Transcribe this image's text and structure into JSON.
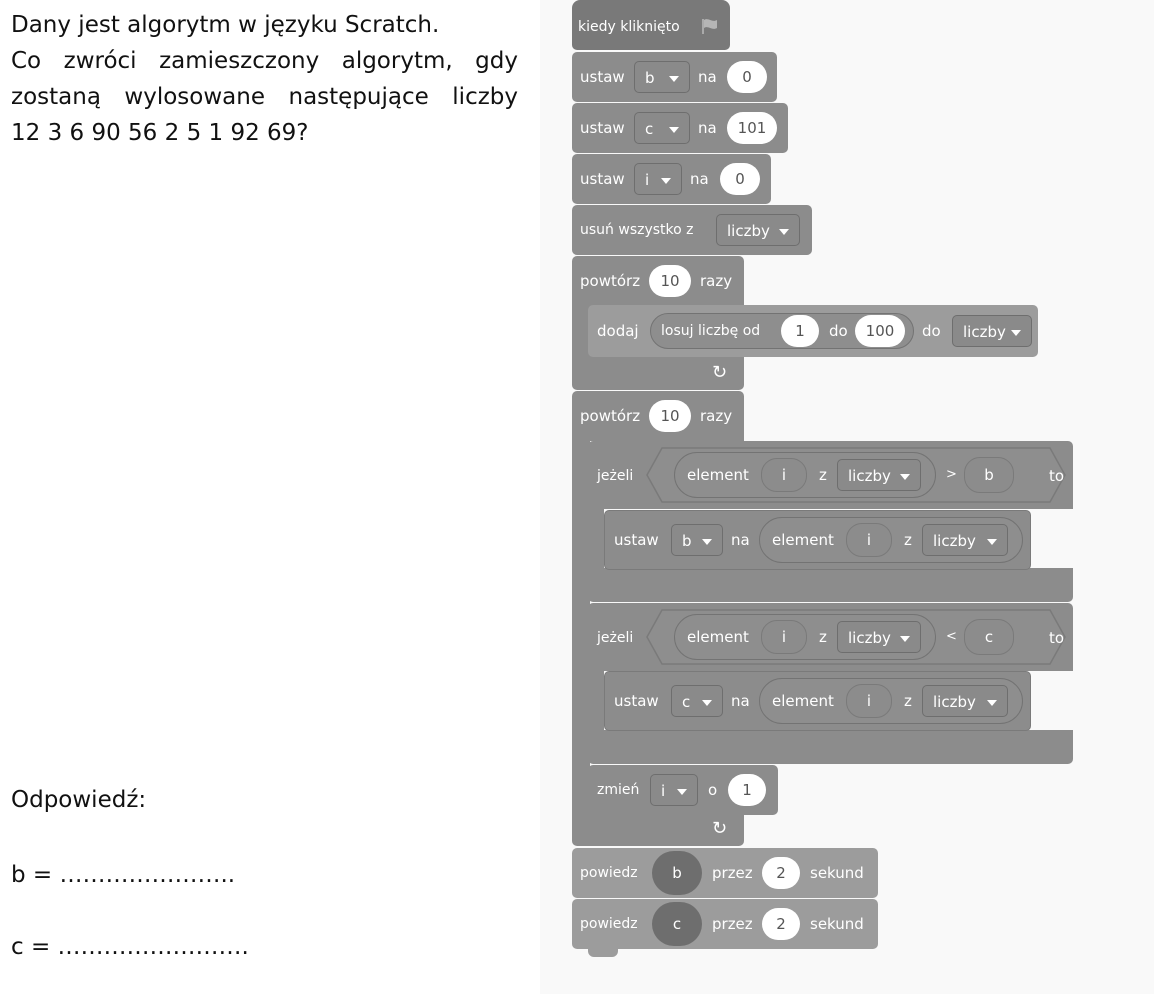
{
  "task": {
    "lines": [
      "Dany jest algorytm w języku Scratch.",
      "Co zwróci zamieszczony algorytm, gdy",
      "zostaną wylosowane następujące liczby",
      "12 3 6 90 56 2 5 1 92 69?"
    ]
  },
  "answer": {
    "label": "Odpowiedź:",
    "b_line": "b = …………………..",
    "c_line": "c = ……………………."
  },
  "scratch": {
    "hat": "kiedy kliknięto",
    "set_b": {
      "kw": "ustaw",
      "var": "b",
      "na": "na",
      "value": "0"
    },
    "set_c": {
      "kw": "ustaw",
      "var": "c",
      "na": "na",
      "value": "101"
    },
    "set_i": {
      "kw": "ustaw",
      "var": "i",
      "na": "na",
      "value": "0"
    },
    "clear": {
      "text": "usuń wszystko z",
      "list": "liczby"
    },
    "repeat1": {
      "kw": "powtórz",
      "count": "10",
      "razy": "razy"
    },
    "add": {
      "kw": "dodaj",
      "random": "losuj liczbę od",
      "from": "1",
      "do": "do",
      "to": "100",
      "do2": "do",
      "list": "liczby"
    },
    "repeat2": {
      "kw": "powtórz",
      "count": "10",
      "razy": "razy"
    },
    "if1": {
      "kw": "jeżeli",
      "element": "element",
      "idx": "i",
      "z": "z",
      "list": "liczby",
      "op": ">",
      "var": "b",
      "to": "to"
    },
    "set_b2": {
      "kw": "ustaw",
      "var": "b",
      "na": "na",
      "element": "element",
      "idx": "i",
      "z": "z",
      "list": "liczby"
    },
    "if2": {
      "kw": "jeżeli",
      "element": "element",
      "idx": "i",
      "z": "z",
      "list": "liczby",
      "op": "<",
      "var": "c",
      "to": "to"
    },
    "set_c2": {
      "kw": "ustaw",
      "var": "c",
      "na": "na",
      "element": "element",
      "idx": "i",
      "z": "z",
      "list": "liczby"
    },
    "change": {
      "kw": "zmień",
      "var": "i",
      "o": "o",
      "value": "1"
    },
    "say_b": {
      "kw": "powiedz",
      "var": "b",
      "przez": "przez",
      "secs": "2",
      "sekund": "sekund"
    },
    "say_c": {
      "kw": "powiedz",
      "var": "c",
      "przez": "przez",
      "secs": "2",
      "sekund": "sekund"
    }
  },
  "colors": {
    "block": "#8c8c8c",
    "hat": "#797979",
    "say": "#9c9c9c",
    "canvas": "#f9f9f9"
  },
  "icons": {
    "flag": "green-flag-icon",
    "loop_arrow": "loop-arrow-icon",
    "dropdown": "dropdown-caret-icon"
  }
}
